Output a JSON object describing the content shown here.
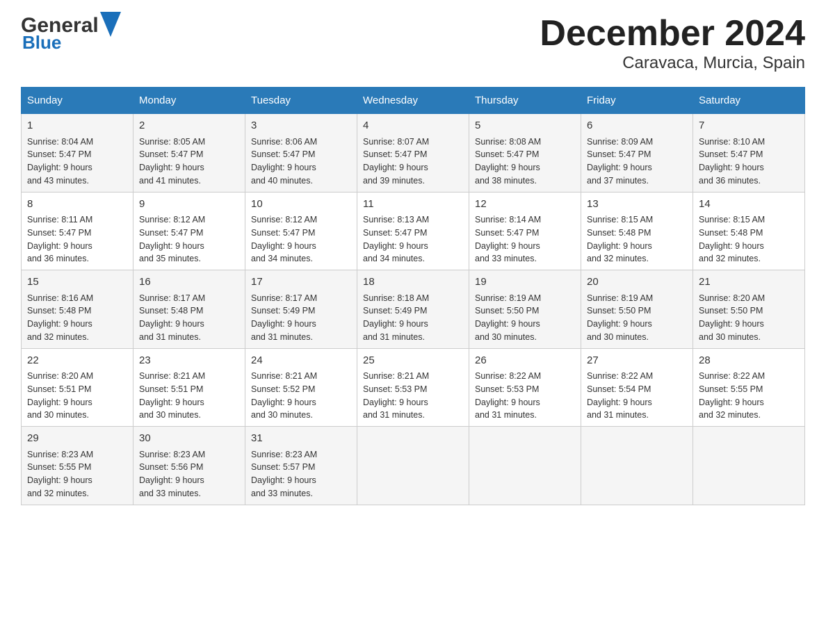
{
  "header": {
    "logo_general": "General",
    "logo_blue": "Blue",
    "title": "December 2024",
    "subtitle": "Caravaca, Murcia, Spain"
  },
  "days_of_week": [
    "Sunday",
    "Monday",
    "Tuesday",
    "Wednesday",
    "Thursday",
    "Friday",
    "Saturday"
  ],
  "weeks": [
    [
      {
        "day": "1",
        "sunrise": "8:04 AM",
        "sunset": "5:47 PM",
        "daylight": "9 hours and 43 minutes."
      },
      {
        "day": "2",
        "sunrise": "8:05 AM",
        "sunset": "5:47 PM",
        "daylight": "9 hours and 41 minutes."
      },
      {
        "day": "3",
        "sunrise": "8:06 AM",
        "sunset": "5:47 PM",
        "daylight": "9 hours and 40 minutes."
      },
      {
        "day": "4",
        "sunrise": "8:07 AM",
        "sunset": "5:47 PM",
        "daylight": "9 hours and 39 minutes."
      },
      {
        "day": "5",
        "sunrise": "8:08 AM",
        "sunset": "5:47 PM",
        "daylight": "9 hours and 38 minutes."
      },
      {
        "day": "6",
        "sunrise": "8:09 AM",
        "sunset": "5:47 PM",
        "daylight": "9 hours and 37 minutes."
      },
      {
        "day": "7",
        "sunrise": "8:10 AM",
        "sunset": "5:47 PM",
        "daylight": "9 hours and 36 minutes."
      }
    ],
    [
      {
        "day": "8",
        "sunrise": "8:11 AM",
        "sunset": "5:47 PM",
        "daylight": "9 hours and 36 minutes."
      },
      {
        "day": "9",
        "sunrise": "8:12 AM",
        "sunset": "5:47 PM",
        "daylight": "9 hours and 35 minutes."
      },
      {
        "day": "10",
        "sunrise": "8:12 AM",
        "sunset": "5:47 PM",
        "daylight": "9 hours and 34 minutes."
      },
      {
        "day": "11",
        "sunrise": "8:13 AM",
        "sunset": "5:47 PM",
        "daylight": "9 hours and 34 minutes."
      },
      {
        "day": "12",
        "sunrise": "8:14 AM",
        "sunset": "5:47 PM",
        "daylight": "9 hours and 33 minutes."
      },
      {
        "day": "13",
        "sunrise": "8:15 AM",
        "sunset": "5:48 PM",
        "daylight": "9 hours and 32 minutes."
      },
      {
        "day": "14",
        "sunrise": "8:15 AM",
        "sunset": "5:48 PM",
        "daylight": "9 hours and 32 minutes."
      }
    ],
    [
      {
        "day": "15",
        "sunrise": "8:16 AM",
        "sunset": "5:48 PM",
        "daylight": "9 hours and 32 minutes."
      },
      {
        "day": "16",
        "sunrise": "8:17 AM",
        "sunset": "5:48 PM",
        "daylight": "9 hours and 31 minutes."
      },
      {
        "day": "17",
        "sunrise": "8:17 AM",
        "sunset": "5:49 PM",
        "daylight": "9 hours and 31 minutes."
      },
      {
        "day": "18",
        "sunrise": "8:18 AM",
        "sunset": "5:49 PM",
        "daylight": "9 hours and 31 minutes."
      },
      {
        "day": "19",
        "sunrise": "8:19 AM",
        "sunset": "5:50 PM",
        "daylight": "9 hours and 30 minutes."
      },
      {
        "day": "20",
        "sunrise": "8:19 AM",
        "sunset": "5:50 PM",
        "daylight": "9 hours and 30 minutes."
      },
      {
        "day": "21",
        "sunrise": "8:20 AM",
        "sunset": "5:50 PM",
        "daylight": "9 hours and 30 minutes."
      }
    ],
    [
      {
        "day": "22",
        "sunrise": "8:20 AM",
        "sunset": "5:51 PM",
        "daylight": "9 hours and 30 minutes."
      },
      {
        "day": "23",
        "sunrise": "8:21 AM",
        "sunset": "5:51 PM",
        "daylight": "9 hours and 30 minutes."
      },
      {
        "day": "24",
        "sunrise": "8:21 AM",
        "sunset": "5:52 PM",
        "daylight": "9 hours and 30 minutes."
      },
      {
        "day": "25",
        "sunrise": "8:21 AM",
        "sunset": "5:53 PM",
        "daylight": "9 hours and 31 minutes."
      },
      {
        "day": "26",
        "sunrise": "8:22 AM",
        "sunset": "5:53 PM",
        "daylight": "9 hours and 31 minutes."
      },
      {
        "day": "27",
        "sunrise": "8:22 AM",
        "sunset": "5:54 PM",
        "daylight": "9 hours and 31 minutes."
      },
      {
        "day": "28",
        "sunrise": "8:22 AM",
        "sunset": "5:55 PM",
        "daylight": "9 hours and 32 minutes."
      }
    ],
    [
      {
        "day": "29",
        "sunrise": "8:23 AM",
        "sunset": "5:55 PM",
        "daylight": "9 hours and 32 minutes."
      },
      {
        "day": "30",
        "sunrise": "8:23 AM",
        "sunset": "5:56 PM",
        "daylight": "9 hours and 33 minutes."
      },
      {
        "day": "31",
        "sunrise": "8:23 AM",
        "sunset": "5:57 PM",
        "daylight": "9 hours and 33 minutes."
      },
      null,
      null,
      null,
      null
    ]
  ],
  "labels": {
    "sunrise": "Sunrise:",
    "sunset": "Sunset:",
    "daylight": "Daylight:"
  }
}
